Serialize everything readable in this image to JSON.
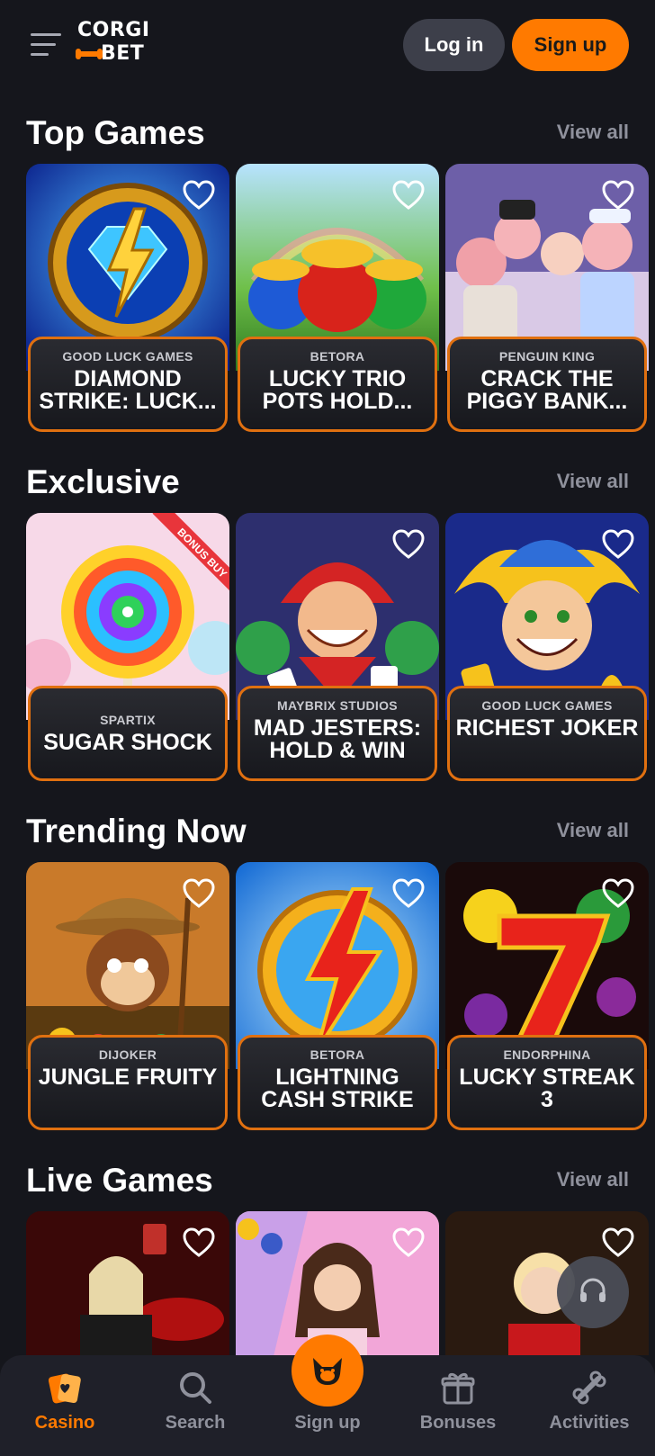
{
  "header": {
    "logo_top": "CORGI",
    "logo_bottom": "BET",
    "login_label": "Log in",
    "signup_label": "Sign up"
  },
  "colors": {
    "accent": "#ff7a00",
    "background": "#15161c",
    "card_border": "#e07010",
    "muted_text": "#8f919c"
  },
  "sections": [
    {
      "title": "Top Games",
      "view_all": "View all",
      "games": [
        {
          "provider": "GOOD LUCK GAMES",
          "title": "DIAMOND STRIKE: LUCK..."
        },
        {
          "provider": "BETORA",
          "title": "LUCKY TRIO POTS HOLD..."
        },
        {
          "provider": "PENGUIN KING",
          "title": "CRACK THE PIGGY BANK..."
        }
      ]
    },
    {
      "title": "Exclusive",
      "view_all": "View all",
      "games": [
        {
          "provider": "SPARTIX",
          "title": "SUGAR SHOCK",
          "badge": "BONUS BUY"
        },
        {
          "provider": "MAYBRIX STUDIOS",
          "title": "MAD JESTERS: HOLD & WIN"
        },
        {
          "provider": "GOOD LUCK GAMES",
          "title": "RICHEST JOKER"
        }
      ]
    },
    {
      "title": "Trending Now",
      "view_all": "View all",
      "games": [
        {
          "provider": "DIJOKER",
          "title": "JUNGLE FRUITY"
        },
        {
          "provider": "BETORA",
          "title": "LIGHTNING CASH STRIKE"
        },
        {
          "provider": "ENDORPHINA",
          "title": "LUCKY STREAK 3"
        }
      ]
    },
    {
      "title": "Live Games",
      "view_all": "View all"
    }
  ],
  "bottom_nav": {
    "casino": "Casino",
    "search": "Search",
    "signup": "Sign up",
    "bonuses": "Bonuses",
    "activities": "Activities"
  }
}
